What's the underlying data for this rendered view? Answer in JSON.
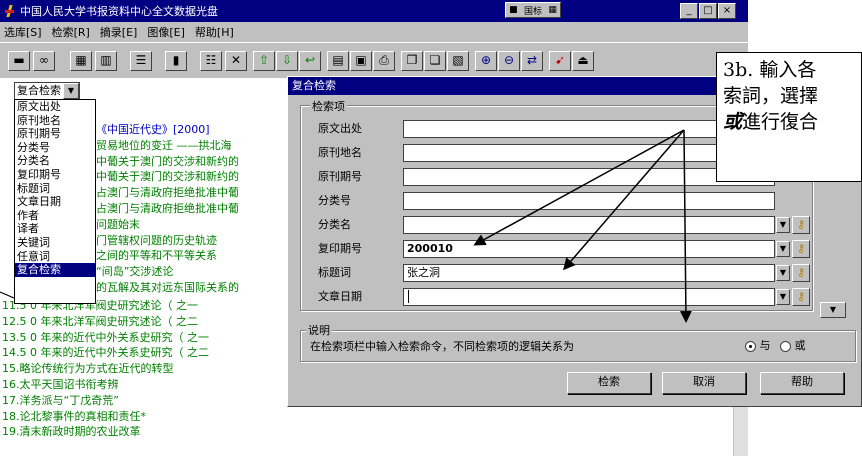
{
  "window": {
    "title": "中国人民大学书报资料中心全文数据光盘",
    "ime_label": "国标",
    "min": "_",
    "max": "□",
    "close": "×"
  },
  "menu": [
    "选库[S]",
    "检索[R]",
    "摘录[E]",
    "图像[E]",
    "帮助[H]"
  ],
  "search_mode": {
    "selected": "复合检索",
    "options": [
      "原文出处",
      "原刊地名",
      "原刊期号",
      "分类号",
      "分类名",
      "复印期号",
      "标题词",
      "文章日期",
      "作者",
      "译者",
      "关键词",
      "任意词",
      "复合检索"
    ]
  },
  "results": {
    "header": "《中国近代史》[2000]",
    "items": [
      "贸易地位的变迁 ——拱北海",
      "中葡关于澳门的交涉和新约的",
      "中葡关于澳门的交涉和新约的",
      "占澳门与清政府拒绝批准中葡",
      "占澳门与清政府拒绝批准中葡",
      "问题始末",
      "门管辖权问题的历史轨迹",
      "之间的平等和不平等关系",
      "“间岛”交涉述论",
      "的瓦解及其对远东国际关系的"
    ],
    "numbered": [
      "11.5 0 年来北洋军阀史研究述论（ 之一",
      "12.5 0 年来北洋军阀史研究述论（ 之二",
      "13.5 0 年来的近代中外关系史研究（ 之一",
      "14.5 0 年来的近代中外关系史研究（ 之二",
      "15.略论传统行为方式在近代的转型",
      "16.太平天国诏书衔考辨",
      "17.洋务派与“丁戊奇荒”",
      "18.论北黎事件的真相和责任*",
      "19.清末新政时期的农业改革"
    ]
  },
  "dialog": {
    "title": "复合检索",
    "group_fields": "检索项",
    "fields": [
      {
        "label": "原文出处",
        "value": ""
      },
      {
        "label": "原刊地名",
        "value": ""
      },
      {
        "label": "原刊期号",
        "value": ""
      },
      {
        "label": "分类号",
        "value": ""
      },
      {
        "label": "分类名",
        "value": ""
      },
      {
        "label": "复印期号",
        "value": "200010"
      },
      {
        "label": "标题词",
        "value": "张之洞"
      },
      {
        "label": "文章日期",
        "value": ""
      }
    ],
    "group_note": "说明",
    "note": "在检索项栏中输入检索命令，不同检索项的逻辑关系为",
    "logic_and": "与",
    "logic_or": "或",
    "logic_selected": "and",
    "buttons": {
      "search": "检索",
      "cancel": "取消",
      "help": "帮助"
    }
  },
  "callout": {
    "line1": "3b. 輸入各",
    "line2": "索詞，選擇",
    "line3_em": "或",
    "line3_rest": "進行復合"
  },
  "colors": {
    "title_bar": "#000080",
    "face": "#c0c0c0",
    "result_text": "#008000",
    "header_text": "#0000c0"
  }
}
